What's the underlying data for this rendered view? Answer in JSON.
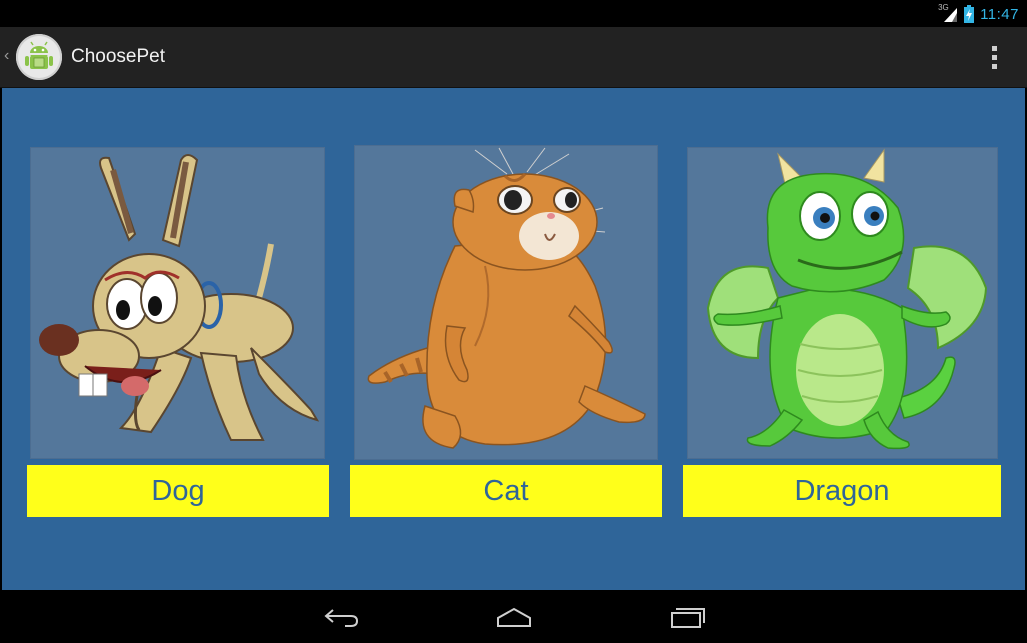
{
  "status_bar": {
    "network_type": "3G",
    "time": "11:47"
  },
  "action_bar": {
    "title": "ChoosePet",
    "app_icon": "android-robot-icon",
    "up_icon": "chevron-left-icon",
    "overflow_icon": "overflow-menu-icon"
  },
  "pets": [
    {
      "label": "Dog",
      "image": "dog-image"
    },
    {
      "label": "Cat",
      "image": "cat-image"
    },
    {
      "label": "Dragon",
      "image": "dragon-image"
    }
  ],
  "colors": {
    "content_background": "#2f6599",
    "label_background": "#ffff1a",
    "label_text": "#2f6599",
    "image_background": "#54779b",
    "clock": "#33b5e5"
  },
  "nav_bar": {
    "back_icon": "back-icon",
    "home_icon": "home-icon",
    "recents_icon": "recent-apps-icon"
  }
}
